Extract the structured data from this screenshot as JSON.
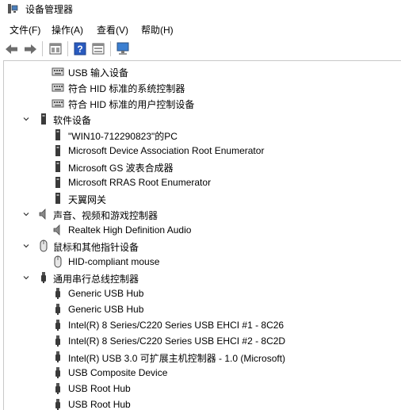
{
  "window": {
    "title": "设备管理器",
    "icon": "device-manager-icon"
  },
  "menu": {
    "items": [
      "文件(F)",
      "操作(A)",
      "查看(V)",
      "帮助(H)"
    ]
  },
  "toolbar": {
    "buttons": [
      "back-arrow-icon",
      "forward-arrow-icon",
      "properties-icon",
      "help-icon",
      "view-icon",
      "monitor-icon"
    ]
  },
  "tree": {
    "hid_children": [
      {
        "label": "USB 输入设备",
        "icon": "keyboard-device-icon"
      },
      {
        "label": "符合 HID 标准的系统控制器",
        "icon": "keyboard-device-icon"
      },
      {
        "label": "符合 HID 标准的用户控制设备",
        "icon": "keyboard-device-icon"
      }
    ],
    "software_devices": {
      "label": "软件设备",
      "icon": "software-device-icon",
      "children": [
        {
          "label": "\"WIN10-712290823\"的PC",
          "icon": "software-device-icon"
        },
        {
          "label": "Microsoft Device Association Root Enumerator",
          "icon": "software-device-icon"
        },
        {
          "label": "Microsoft GS 波表合成器",
          "icon": "software-device-icon"
        },
        {
          "label": "Microsoft RRAS Root Enumerator",
          "icon": "software-device-icon"
        },
        {
          "label": "天翼网关",
          "icon": "software-device-icon"
        }
      ]
    },
    "sound": {
      "label": "声音、视频和游戏控制器",
      "icon": "speaker-icon",
      "children": [
        {
          "label": "Realtek High Definition Audio",
          "icon": "speaker-icon"
        }
      ]
    },
    "mice": {
      "label": "鼠标和其他指针设备",
      "icon": "mouse-icon",
      "children": [
        {
          "label": "HID-compliant mouse",
          "icon": "mouse-icon"
        }
      ]
    },
    "usb": {
      "label": "通用串行总线控制器",
      "icon": "usb-icon",
      "children": [
        {
          "label": "Generic USB Hub",
          "icon": "usb-icon"
        },
        {
          "label": "Generic USB Hub",
          "icon": "usb-icon"
        },
        {
          "label": "Intel(R) 8 Series/C220 Series USB EHCI #1 - 8C26",
          "icon": "usb-icon"
        },
        {
          "label": "Intel(R) 8 Series/C220 Series USB EHCI #2 - 8C2D",
          "icon": "usb-icon"
        },
        {
          "label": "Intel(R) USB 3.0 可扩展主机控制器 - 1.0 (Microsoft)",
          "icon": "usb-icon"
        },
        {
          "label": "USB Composite Device",
          "icon": "usb-icon"
        },
        {
          "label": "USB Root Hub",
          "icon": "usb-icon"
        },
        {
          "label": "USB Root Hub",
          "icon": "usb-icon"
        }
      ]
    }
  },
  "colors": {
    "border": "#c8c8c8",
    "icon_dark": "#3a3a3a",
    "help_blue": "#2a5bbf"
  }
}
